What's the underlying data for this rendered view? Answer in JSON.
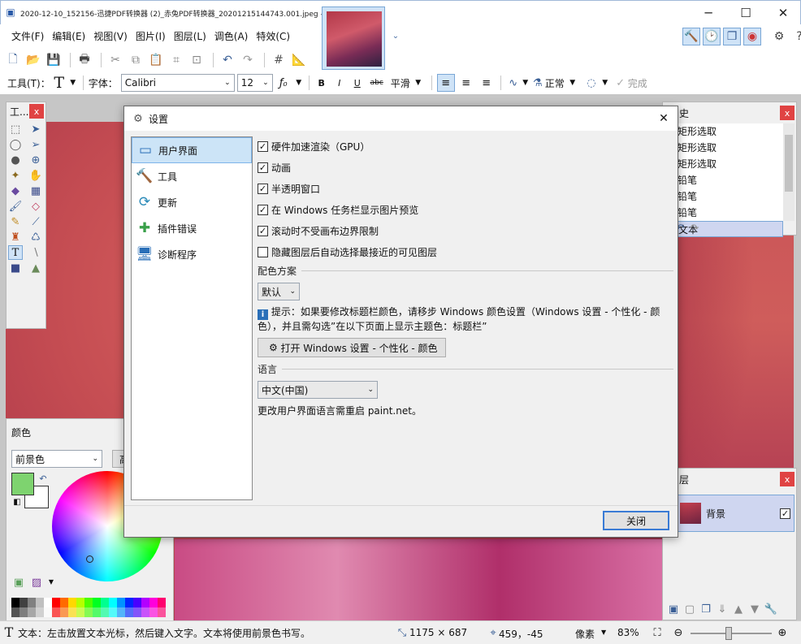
{
  "window": {
    "title": "2020-12-10_152156-迅捷PDF转换器 (2)_赤兔PDF转换器_20201215144743.001.jpeg - paint.net 4.2.14",
    "minimize": "─",
    "maximize": "☐",
    "close": "✕"
  },
  "menu": [
    "文件(F)",
    "编辑(E)",
    "视图(V)",
    "图片(I)",
    "图层(L)",
    "调色(A)",
    "特效(C)"
  ],
  "toolbar": {
    "tool_label": "工具(T)：",
    "font_label": "字体：",
    "font_value": "Calibri",
    "size_value": "12",
    "antialias": "平滑",
    "blend": "正常",
    "finish": "完成",
    "bold": "B",
    "italic": "I",
    "underline": "U",
    "strike": "abc"
  },
  "panels": {
    "tools_title": "工...",
    "color_title": "颜色",
    "color_mode": "前景色",
    "color_more": "高",
    "history_title": "史",
    "history_items": [
      "矩形选取",
      "矩形选取",
      "矩形选取",
      "铅笔",
      "铅笔",
      "铅笔",
      "文本"
    ],
    "layers_title": "层",
    "layer_name": "背景",
    "palette": [
      "#000000",
      "#404040",
      "#808080",
      "#c0c0c0",
      "#ffffff",
      "#ff0000",
      "#ff6a00",
      "#ffd800",
      "#b6ff00",
      "#4cff00",
      "#00ff21",
      "#00ff90",
      "#00ffff",
      "#0094ff",
      "#0026ff",
      "#4800ff",
      "#b200ff",
      "#ff00dc",
      "#ff006e"
    ]
  },
  "dialog": {
    "title": "设置",
    "nav": [
      {
        "label": "用户界面",
        "icon": "window-icon"
      },
      {
        "label": "工具",
        "icon": "hammer-icon"
      },
      {
        "label": "更新",
        "icon": "refresh-icon"
      },
      {
        "label": "插件错误",
        "icon": "puzzle-icon"
      },
      {
        "label": "诊断程序",
        "icon": "monitor-icon"
      }
    ],
    "options": [
      {
        "label": "硬件加速渲染（GPU）",
        "checked": true
      },
      {
        "label": "动画",
        "checked": true
      },
      {
        "label": "半透明窗口",
        "checked": true
      },
      {
        "label": "在 Windows 任务栏显示图片预览",
        "checked": true
      },
      {
        "label": "滚动时不受画布边界限制",
        "checked": true
      },
      {
        "label": "隐藏图层后自动选择最接近的可见图层",
        "checked": false
      }
    ],
    "scheme_header": "配色方案",
    "scheme_value": "默认",
    "hint": "提示：如果要修改标题栏颜色，请移步 Windows 颜色设置（Windows 设置 - 个性化 - 颜色），并且需勾选”在以下页面上显示主题色：标题栏”",
    "open_settings": "打开 Windows 设置 - 个性化 - 颜色",
    "language_header": "语言",
    "language_value": "中文(中国)",
    "language_note": "更改用户界面语言需重启 paint.net。",
    "close_button": "关闭"
  },
  "status": {
    "hint": "文本：左击放置文本光标，然后键入文字。文本将使用前景色书写。",
    "image_size": "1175 × 687",
    "cursor_pos": "459，-45",
    "unit": "像素",
    "zoom": "83%"
  }
}
